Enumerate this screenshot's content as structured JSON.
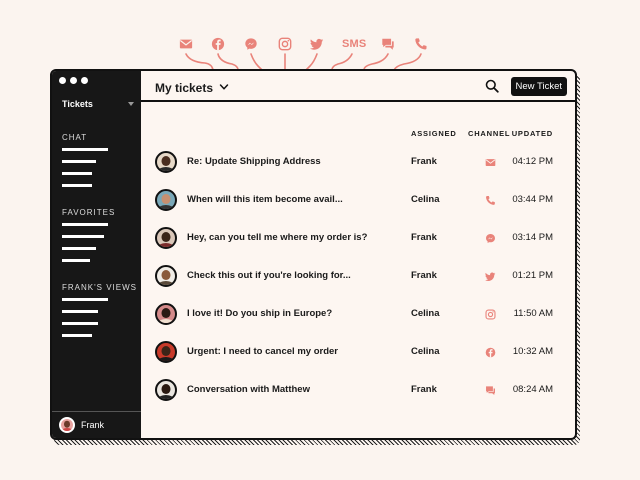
{
  "colors": {
    "accent": "#e9837a",
    "dark": "#171717",
    "background": "#fbf4ef"
  },
  "channels_top": [
    {
      "icon": "mail-icon"
    },
    {
      "icon": "facebook-icon"
    },
    {
      "icon": "messenger-icon"
    },
    {
      "icon": "instagram-icon"
    },
    {
      "icon": "twitter-icon"
    },
    {
      "icon": "sms-icon",
      "label": "SMS"
    },
    {
      "icon": "chat-icon"
    },
    {
      "icon": "phone-icon"
    }
  ],
  "sidebar": {
    "selector_label": "Tickets",
    "sections": [
      {
        "title": "CHAT"
      },
      {
        "title": "FAVORITES"
      },
      {
        "title": "FRANK'S VIEWS"
      }
    ],
    "user": {
      "name": "Frank"
    }
  },
  "header": {
    "title": "My tickets",
    "new_ticket_label": "New Ticket"
  },
  "table": {
    "columns": {
      "assigned": "ASSIGNED",
      "channel": "CHANNEL",
      "updated": "UPDATED"
    },
    "rows": [
      {
        "subject": "Re: Update Shipping Address",
        "assignee": "Frank",
        "channel": "mail-icon",
        "updated": "04:12 PM"
      },
      {
        "subject": "When will this item become avail...",
        "assignee": "Celina",
        "channel": "phone-icon",
        "updated": "03:44 PM"
      },
      {
        "subject": "Hey, can you tell me where my order is?",
        "assignee": "Frank",
        "channel": "messenger-icon",
        "updated": "03:14 PM"
      },
      {
        "subject": "Check this out if you're looking for...",
        "assignee": "Frank",
        "channel": "twitter-icon",
        "updated": "01:21 PM"
      },
      {
        "subject": "I love it! Do you ship in Europe?",
        "assignee": "Celina",
        "channel": "instagram-icon",
        "updated": "11:50 AM"
      },
      {
        "subject": "Urgent: I need to cancel my order",
        "assignee": "Celina",
        "channel": "facebook-icon",
        "updated": "10:32 AM"
      },
      {
        "subject": "Conversation with Matthew",
        "assignee": "Frank",
        "channel": "chat-icon",
        "updated": "08:24 AM"
      }
    ]
  }
}
